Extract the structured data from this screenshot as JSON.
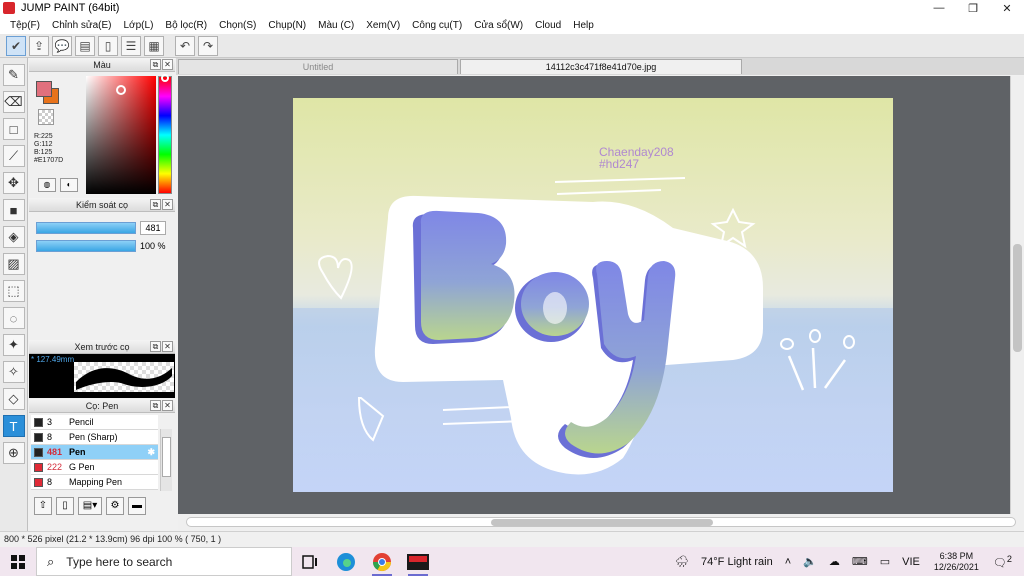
{
  "window": {
    "title": "JUMP PAINT (64bit)",
    "controls": {
      "minimize": "—",
      "restore": "❐",
      "close": "✕"
    }
  },
  "menu": [
    "Tệp(F)",
    "Chỉnh sửa(E)",
    "Lớp(L)",
    "Bộ lọc(R)",
    "Chọn(S)",
    "Chụp(N)",
    "Màu (C)",
    "Xem(V)",
    "Công cụ(T)",
    "Cửa sổ(W)",
    "Cloud",
    "Help"
  ],
  "toolbar_icons": [
    "check-icon",
    "share-icon",
    "speech-icon",
    "comment-icon",
    "page-icon",
    "layers-icon",
    "grid-icon",
    "undo-icon",
    "redo-icon"
  ],
  "tools": [
    "brush",
    "eraser",
    "select-rect",
    "dropper",
    "move",
    "fill-rect",
    "bucket",
    "gradient",
    "marquee",
    "lasso",
    "magic-wand",
    "magic-select",
    "select-eraser",
    "text",
    "operation"
  ],
  "panels": {
    "color": {
      "title": "Màu",
      "r": "R:225",
      "g": "G:112",
      "b": "B:125",
      "hex": "#E1707D",
      "main_color": "#E1707D",
      "sub_color": "#E8731C"
    },
    "brush_control": {
      "title": "Kiểm soát cọ",
      "size_value": "481",
      "opacity_value": "100 %"
    },
    "preview": {
      "title": "Xem trước cọ",
      "size_label": "* 127.49mm"
    },
    "brush_list": {
      "title": "Cọ: Pen",
      "items": [
        {
          "size": "3",
          "name": "Pencil",
          "color": "#222222"
        },
        {
          "size": "8",
          "name": "Pen (Sharp)",
          "color": "#222222"
        },
        {
          "size": "481",
          "name": "Pen",
          "color": "#222222"
        },
        {
          "size": "222",
          "name": "G Pen",
          "color": "#e02a36"
        },
        {
          "size": "8",
          "name": "Mapping Pen",
          "color": "#e02a36"
        }
      ]
    }
  },
  "tabs": [
    "Untitled",
    "14112c3c471f8e41d70e.jpg"
  ],
  "artwork": {
    "signature_line1": "Chaenday208",
    "signature_line2": "#hd247",
    "word": "Boy"
  },
  "status": "800 * 526 pixel  (21.2 * 13.9cm)  96 dpi  100 %  ( 750, 1 )",
  "taskbar": {
    "search_placeholder": "Type here to search",
    "weather": "74°F  Light rain",
    "lang": "VIE",
    "time": "6:38 PM",
    "date": "12/26/2021",
    "notif_count": "2"
  }
}
